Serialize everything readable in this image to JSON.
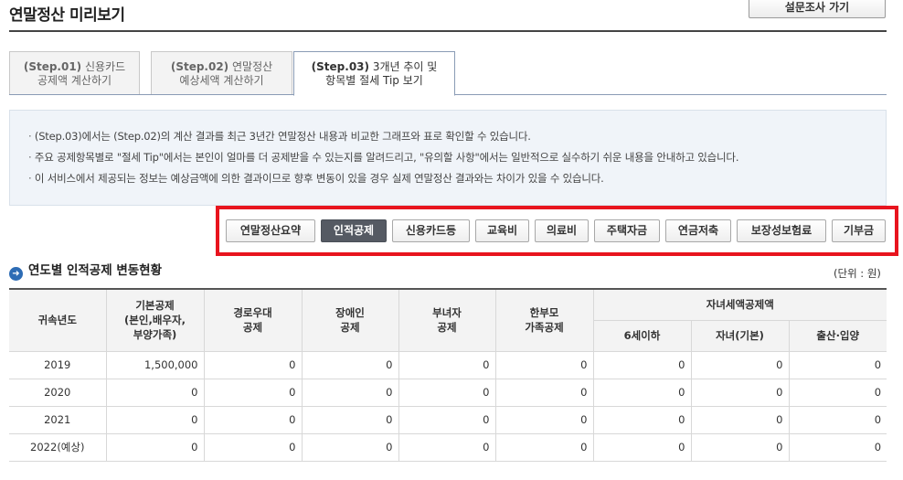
{
  "header": {
    "title": "연말정산 미리보기",
    "survey_button": "설문조사 가기"
  },
  "tabs": [
    {
      "step": "(Step.01)",
      "label_line1": "신용카드",
      "label_line2": "공제액 계산하기"
    },
    {
      "step": "(Step.02)",
      "label_line1": "연말정산",
      "label_line2": "예상세액 계산하기"
    },
    {
      "step": "(Step.03)",
      "label_line1": "3개년 추이 및",
      "label_line2": "항목별 절세 Tip 보기"
    }
  ],
  "active_tab": 2,
  "info": [
    "(Step.03)에서는 (Step.02)의 계산 결과를 최근 3년간 연말정산 내용과 비교한 그래프와 표로 확인할 수 있습니다.",
    "주요 공제항목별로 \"절세 Tip\"에서는 본인이 얼마를 더 공제받을 수 있는지를 알려드리고, \"유의할 사항\"에서는 일반적으로 실수하기 쉬운 내용을 안내하고 있습니다.",
    "이 서비스에서 제공되는 정보는 예상금액에 의한 결과이므로 향후 변동이 있을 경우 실제 연말정산 결과와는 차이가 있을 수 있습니다."
  ],
  "categories": [
    "연말정산요약",
    "인적공제",
    "신용카드등",
    "교육비",
    "의료비",
    "주택자금",
    "연금저축",
    "보장성보험료",
    "기부금"
  ],
  "active_category": 1,
  "section": {
    "title": "연도별 인적공제 변동현황",
    "unit": "(단위 : 원)"
  },
  "table": {
    "headers": {
      "year": "귀속년도",
      "basic_line1": "기본공제",
      "basic_line2": "(본인,배우자,",
      "basic_line3": "부양가족)",
      "elderly_line1": "경로우대",
      "elderly_line2": "공제",
      "disabled_line1": "장애인",
      "disabled_line2": "공제",
      "female_line1": "부녀자",
      "female_line2": "공제",
      "single_parent_line1": "한부모",
      "single_parent_line2": "가족공제",
      "child_group": "자녀세액공제액",
      "child_under6": "6세이하",
      "child_basic": "자녀(기본)",
      "child_birth": "출산·입양"
    },
    "rows": [
      {
        "year": "2019",
        "basic": "1,500,000",
        "elderly": "0",
        "disabled": "0",
        "female": "0",
        "single_parent": "0",
        "child_under6": "0",
        "child_basic": "0",
        "child_birth": "0"
      },
      {
        "year": "2020",
        "basic": "0",
        "elderly": "0",
        "disabled": "0",
        "female": "0",
        "single_parent": "0",
        "child_under6": "0",
        "child_basic": "0",
        "child_birth": "0"
      },
      {
        "year": "2021",
        "basic": "0",
        "elderly": "0",
        "disabled": "0",
        "female": "0",
        "single_parent": "0",
        "child_under6": "0",
        "child_basic": "0",
        "child_birth": "0"
      },
      {
        "year": "2022(예상)",
        "basic": "0",
        "elderly": "0",
        "disabled": "0",
        "female": "0",
        "single_parent": "0",
        "child_under6": "0",
        "child_basic": "0",
        "child_birth": "0"
      }
    ]
  },
  "colors": {
    "highlight_frame": "#e8141e",
    "active_category_bg": "#555a63",
    "section_icon": "#2d6cb5",
    "info_bg": "#f0f4f9"
  }
}
